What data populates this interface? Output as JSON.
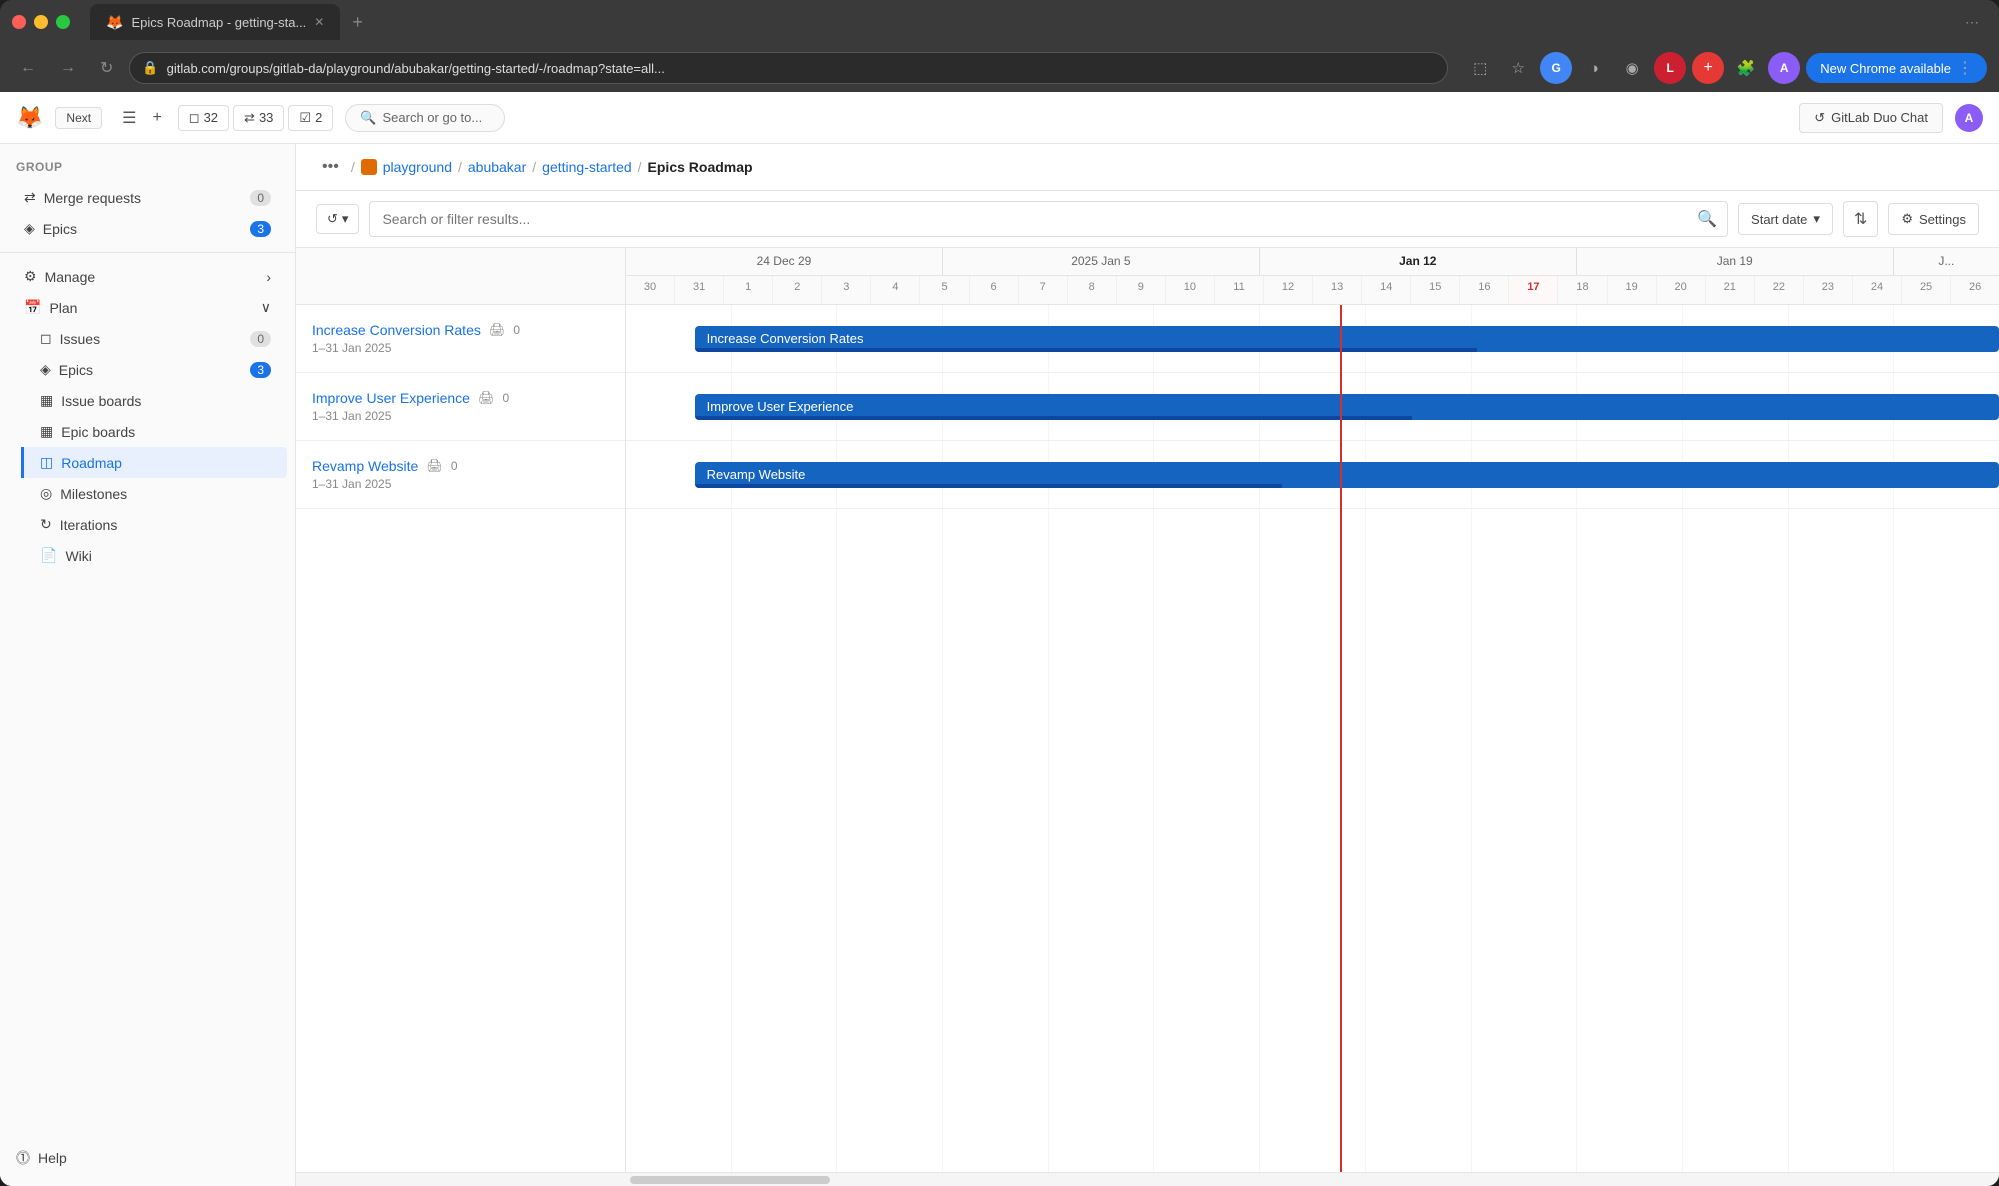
{
  "browser": {
    "tab_title": "Epics Roadmap - getting-sta...",
    "tab_plus": "+",
    "url": "gitlab.com/groups/gitlab-da/playground/abubakar/getting-started/-/roadmap?state=all...",
    "chrome_badge": "New Chrome available"
  },
  "header": {
    "next_label": "Next",
    "stats": {
      "issues": "32",
      "merge_requests": "33",
      "todos": "2"
    },
    "search_placeholder": "Search or go to...",
    "duo_chat": "GitLab Duo Chat"
  },
  "breadcrumb": {
    "dots": "•••",
    "playground": "playground",
    "abubakar": "abubakar",
    "getting_started": "getting-started",
    "current": "Epics Roadmap"
  },
  "toolbar": {
    "history_label": "History",
    "search_placeholder": "Search or filter results...",
    "start_date_label": "Start date",
    "settings_label": "Settings"
  },
  "sidebar": {
    "group_label": "Group",
    "merge_requests": "Merge requests",
    "merge_requests_count": "0",
    "epics_top": "Epics",
    "epics_top_count": "3",
    "manage_label": "Manage",
    "plan_label": "Plan",
    "plan_items": [
      {
        "label": "Issues",
        "count": "0"
      },
      {
        "label": "Epics",
        "count": "3"
      },
      {
        "label": "Issue boards",
        "count": ""
      },
      {
        "label": "Epic boards",
        "count": ""
      },
      {
        "label": "Roadmap",
        "count": "",
        "active": true
      },
      {
        "label": "Milestones",
        "count": ""
      },
      {
        "label": "Iterations",
        "count": ""
      },
      {
        "label": "Wiki",
        "count": ""
      }
    ],
    "help_label": "Help"
  },
  "timeline": {
    "week_headers": [
      {
        "label": "24 Dec 29",
        "days": [
          "30",
          "31",
          "1",
          "2",
          "3",
          "4",
          "5",
          "6",
          "7",
          "8",
          "9",
          "10",
          "11",
          "12",
          "13",
          "14",
          "15",
          "16",
          "17",
          "18",
          "19",
          "20",
          "21",
          "22",
          "23",
          "24",
          "25",
          "26"
        ]
      },
      {
        "label": "2025 Jan 5",
        "current": false
      },
      {
        "label": "Jan 12",
        "current": true
      },
      {
        "label": "Jan 19",
        "current": false
      }
    ],
    "today_day": "17"
  },
  "epics": [
    {
      "title": "Increase Conversion Rates",
      "date": "1–31 Jan 2025",
      "icon_count": "0",
      "bar_label": "Increase Conversion Rates",
      "bar_left_pct": 48,
      "bar_width_pct": 52,
      "progress_pct": 60
    },
    {
      "title": "Improve User Experience",
      "date": "1–31 Jan 2025",
      "icon_count": "0",
      "bar_label": "Improve User Experience",
      "bar_left_pct": 48,
      "bar_width_pct": 52,
      "progress_pct": 55
    },
    {
      "title": "Revamp Website",
      "date": "1–31 Jan 2025",
      "icon_count": "0",
      "bar_label": "Revamp Website",
      "bar_left_pct": 48,
      "bar_width_pct": 52,
      "progress_pct": 45
    }
  ],
  "colors": {
    "accent": "#1a73e8",
    "today_line": "#d32f2f",
    "bar_bg": "#1565c0",
    "bar_progress": "#0d47a1"
  }
}
